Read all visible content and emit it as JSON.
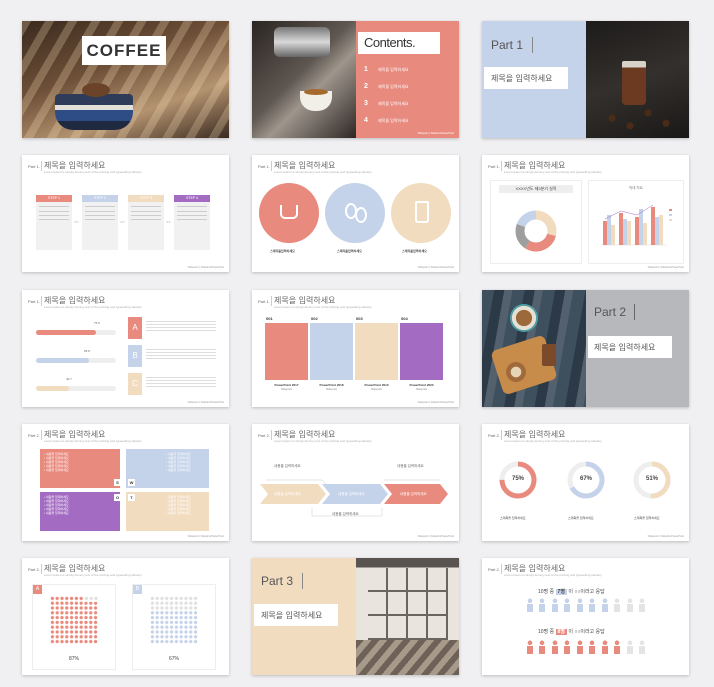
{
  "s1": {
    "title": "COFFEE"
  },
  "s2": {
    "title": "Contents.",
    "items": [
      {
        "num": "1",
        "text": "제목을 입력하세요"
      },
      {
        "num": "2",
        "text": "제목을 입력하세요"
      },
      {
        "num": "3",
        "text": "제목을 입력하세요"
      },
      {
        "num": "4",
        "text": "제목을 입력하세요"
      }
    ]
  },
  "s3": {
    "part": "Part 1",
    "subtitle": "제목을 입력하세요"
  },
  "common": {
    "slide_title": "제목을 입력하세요",
    "part1": "Part 1.",
    "part2": "Part 2.",
    "desc": "Lorem Ipsum is simply dummy text of the printing and typesetting industry.",
    "footer": "Slidepoint | SlidesForPowerPoint"
  },
  "s4": {
    "steps": [
      "STEP 1",
      "STEP 2",
      "STEP 3",
      "STEP 4"
    ]
  },
  "s5": {
    "label": "스제목을입력하세요"
  },
  "s6": {
    "donut_title": "XXXX년도 제3분기 실적",
    "bar_title": "막대 차트"
  },
  "s7": {
    "letters": [
      "A",
      "B",
      "C"
    ],
    "percents": [
      "75.6",
      "65.8",
      "40.7"
    ]
  },
  "s8": {
    "nums": [
      "001",
      "002",
      "003",
      "004"
    ],
    "labels": [
      "PowerPoint 2017",
      "PowerPoint 2018",
      "PowerPoint 2019",
      "PowerPoint 2020"
    ],
    "sublabel": "Slidepoint"
  },
  "s9": {
    "part": "Part 2",
    "subtitle": "제목을 입력하세요"
  },
  "s10": {
    "item": "• 내용을 입력하세요",
    "letters": [
      "S",
      "W",
      "O",
      "T"
    ]
  },
  "s11": {
    "top1": "내용을 입력하세요",
    "top2": "내용을 입력하세요",
    "bottom": "내용을 입력하세요",
    "a1": "내용을 입력하세요",
    "a2": "내용을 입력하세요",
    "a3": "내용을 입력하세요"
  },
  "s12": {
    "percents": [
      "75%",
      "67%",
      "51%"
    ],
    "label": "스제목을 입력하세요"
  },
  "s13": {
    "letters": [
      "A",
      "B"
    ],
    "percents": [
      "87%",
      "67%"
    ]
  },
  "s14": {
    "part": "Part 3",
    "subtitle": "제목을 입력하세요"
  },
  "s15": {
    "line1": {
      "pre": "10명 중",
      "num": "7명",
      "post": "이 ○○이라고 응답"
    },
    "line2": {
      "pre": "10명 중",
      "num": "8명",
      "post": "이 ○○이라고 응답"
    }
  },
  "colors": {
    "salmon": "#e98a7e",
    "blue": "#c5d3ea",
    "peach": "#f2dcc0",
    "purple": "#a46bc2"
  }
}
